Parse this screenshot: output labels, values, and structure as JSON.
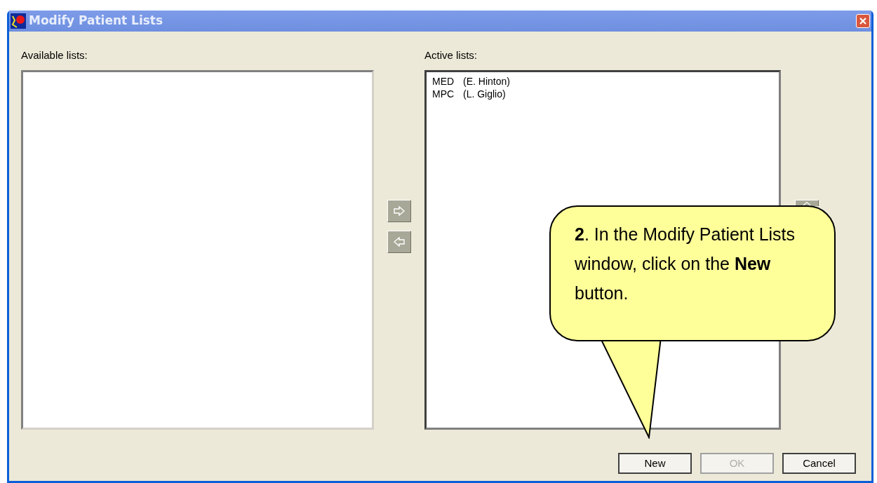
{
  "window": {
    "title": "Modify Patient Lists"
  },
  "available_lists": {
    "label": "Available lists:"
  },
  "active_lists": {
    "label": "Active lists:",
    "items": [
      {
        "code": "MED",
        "owner": "(E. Hinton)"
      },
      {
        "code": "MPC",
        "owner": "(L. Giglio)"
      }
    ]
  },
  "buttons": [
    {
      "label": "New",
      "disabled": false
    },
    {
      "label": "OK",
      "disabled": true
    },
    {
      "label": "Cancel",
      "disabled": false
    }
  ],
  "callout": {
    "text": "**2**. In the Modify Patient Lists window, click on the **New** button."
  }
}
